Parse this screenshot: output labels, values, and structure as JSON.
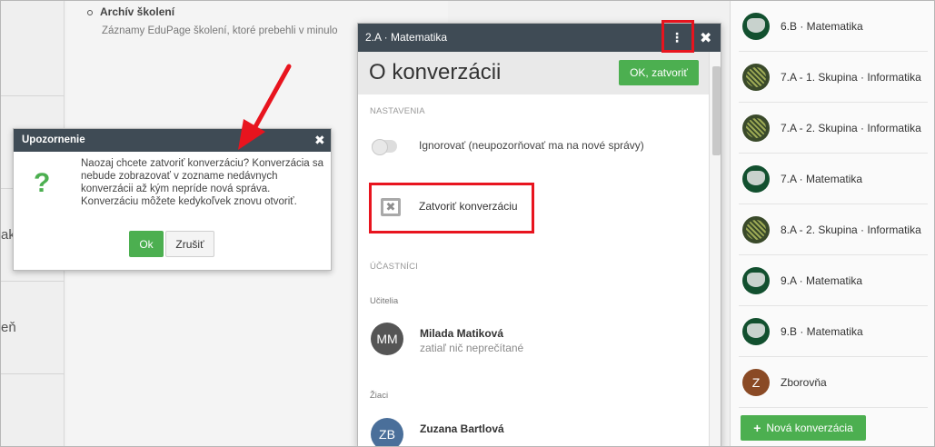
{
  "background": {
    "archiv_title": "Archív školení",
    "archiv_desc": "Záznamy EduPage školení, ktoré prebehli v minulo",
    "left_fragments": [
      "ak",
      "eň"
    ]
  },
  "conversation_list": {
    "items": [
      {
        "label": "6.B · Matematika",
        "icon": "math-avatar-icon"
      },
      {
        "label": "7.A - 1. Skupina · Informatika",
        "icon": "info-avatar-icon"
      },
      {
        "label": "7.A - 2. Skupina · Informatika",
        "icon": "info-avatar-icon"
      },
      {
        "label": "7.A · Matematika",
        "icon": "math-avatar-icon"
      },
      {
        "label": "8.A - 2. Skupina · Informatika",
        "icon": "info-avatar-icon"
      },
      {
        "label": "9.A · Matematika",
        "icon": "math-avatar-icon"
      },
      {
        "label": "9.B · Matematika",
        "icon": "math-avatar-icon"
      },
      {
        "label": "Zborovňa",
        "initial": "Z"
      }
    ],
    "new_button": "Nová konverzácia"
  },
  "conv_modal": {
    "header_title": "2.A · Matematika",
    "menu_glyph": "⋮",
    "close_glyph": "✖",
    "about_title": "O konverzácii",
    "ok_close_label": "OK, zatvoriť",
    "settings_label": "NASTAVENIA",
    "ignore_label": "Ignorovať (neupozorňovať ma na nové správy)",
    "close_conv_label": "Zatvoriť konverzáciu",
    "participants_label": "ÚČASTNÍCI",
    "teachers_label": "Učitelia",
    "students_label": "Žiaci",
    "teacher": {
      "initials": "MM",
      "name": "Milada Matiková",
      "status": "zatiaľ nič neprečítané"
    },
    "student": {
      "initials": "ZB",
      "name": "Zuzana Bartlová"
    }
  },
  "warning": {
    "title": "Upozornenie",
    "close_glyph": "✖",
    "icon_glyph": "?",
    "message": "Naozaj chcete zatvoriť konverzáciu? Konverzácia sa nebude zobrazovať v zozname nedávnych konverzácii až kým nepríde nová správa. Konverzáciu môžete kedykoľvek znovu otvoriť.",
    "ok_label": "Ok",
    "cancel_label": "Zrušiť"
  },
  "colors": {
    "accent_green": "#4caf50",
    "header_dark": "#3f4b55",
    "highlight_red": "#e8141e"
  }
}
